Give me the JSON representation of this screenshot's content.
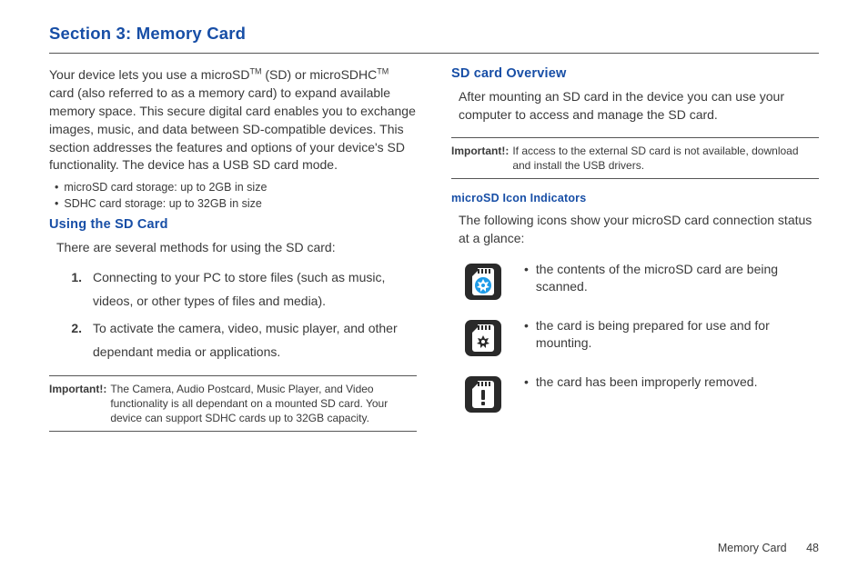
{
  "section_title": "Section 3: Memory Card",
  "left": {
    "intro_p1": "Your device lets you use a microSD",
    "intro_p2": " (SD) or microSDHC",
    "intro_p3": " card (also referred to as a memory card) to expand available memory space. This secure digital card enables you to exchange images, music, and data between SD-compatible devices. This section addresses the features and options of your device's SD functionality. The device has a USB SD card mode.",
    "bullets": [
      "microSD card storage: up to 2GB in size",
      "SDHC card storage: up to 32GB in size"
    ],
    "using_heading": "Using the SD Card",
    "using_intro": "There are several methods for using the SD card:",
    "methods": [
      {
        "num": "1.",
        "text": "Connecting to your PC to store files (such as music, videos, or other types of files and media)."
      },
      {
        "num": "2.",
        "text": "To activate the camera, video, music player, and other dependant media or applications."
      }
    ],
    "important_label": "Important!:",
    "important_text": "The Camera, Audio Postcard, Music Player, and Video functionality is all dependant on a mounted SD card. Your device can support SDHC cards up to 32GB capacity."
  },
  "right": {
    "overview_heading": "SD card Overview",
    "overview_text": "After mounting an SD card in the device you can use your computer to access and manage the SD card.",
    "important_label": "Important!:",
    "important_text": "If access to the external SD card is not available, download and install the USB drivers.",
    "indicators_heading": "microSD Icon Indicators",
    "indicators_intro": "The following icons show your microSD card connection status at a glance:",
    "icons": [
      {
        "name": "sd-scan-icon",
        "text": "the contents of the microSD card are being scanned."
      },
      {
        "name": "sd-prepare-icon",
        "text": "the card is being prepared for use and for mounting."
      },
      {
        "name": "sd-removed-icon",
        "text": "the card has been improperly removed."
      }
    ]
  },
  "footer": {
    "label": "Memory Card",
    "page": "48"
  },
  "tm": "TM"
}
